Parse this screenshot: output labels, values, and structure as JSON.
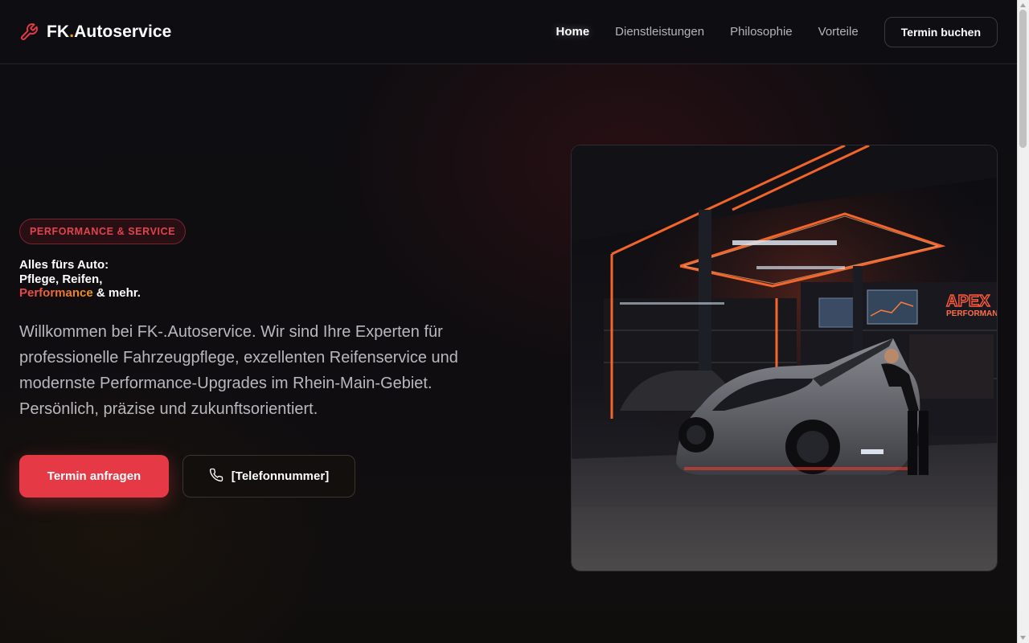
{
  "brand": {
    "name_prefix": "FK",
    "name_dot": ".",
    "name_suffix": "Autoservice",
    "icon": "wrench-icon",
    "icon_color": "#e63946",
    "dot_color": "#f39a1c"
  },
  "nav": {
    "items": [
      {
        "label": "Home",
        "active": true
      },
      {
        "label": "Dienstleistungen",
        "active": false
      },
      {
        "label": "Philosophie",
        "active": false
      },
      {
        "label": "Vorteile",
        "active": false
      }
    ],
    "cta_label": "Termin buchen"
  },
  "hero": {
    "badge": "PERFORMANCE & SERVICE",
    "headline_line1": "Alles fürs Auto:",
    "headline_line2": "Pflege, Reifen,",
    "headline_accent": "Performance",
    "headline_tail": " & mehr.",
    "lead": "Willkommen bei FK-.Autoservice. Wir sind Ihre Experten für professionelle Fahrzeugpflege, exzellenten Reifenservice und modernste Performance-Upgrades im Rhein-Main-Gebiet. Persönlich, präzise und zukunftsorientiert.",
    "primary_button": "Termin anfragen",
    "phone_button": "[Telefonnummer]",
    "phone_icon": "phone-icon",
    "image_sign_line1": "APEX",
    "image_sign_line2": "PERFORMAN"
  },
  "colors": {
    "accent": "#e63946",
    "accent_secondary": "#f39a1c",
    "background": "#0e0d11"
  }
}
